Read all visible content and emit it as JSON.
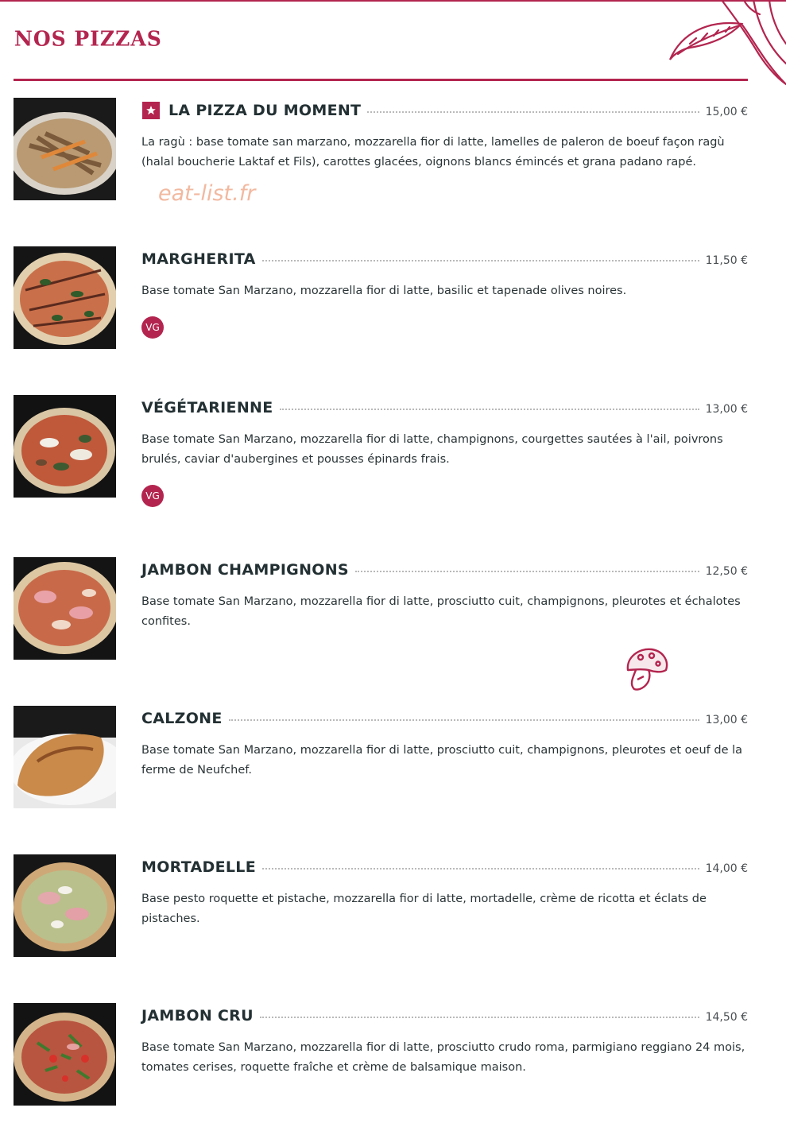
{
  "section": {
    "title": "NOS PIZZAS"
  },
  "watermark": "eat-list.fr",
  "items": [
    {
      "name": "LA PIZZA DU MOMENT",
      "price": "15,00 €",
      "description": "La ragù : base tomate san marzano, mozzarella fior di latte, lamelles de paleron de boeuf façon ragù (halal boucherie Laktaf et Fils), carottes glacées, oignons blancs émincés et grana padano rapé.",
      "featured_icon": "star-icon"
    },
    {
      "name": "MARGHERITA",
      "price": "11,50 €",
      "description": "Base tomate San Marzano, mozzarella fior di latte, basilic et tapenade olives noires.",
      "badge": "VG"
    },
    {
      "name": "VÉGÉTARIENNE",
      "price": "13,00 €",
      "description": "Base tomate San Marzano, mozzarella fior di latte, champignons, courgettes sautées à l'ail, poivrons brulés, caviar d'aubergines et pousses épinards frais.",
      "badge": "VG"
    },
    {
      "name": "JAMBON CHAMPIGNONS",
      "price": "12,50 €",
      "description": "Base tomate San Marzano, mozzarella fior di latte, prosciutto cuit, champignons, pleurotes et échalotes confites."
    },
    {
      "name": "CALZONE",
      "price": "13,00 €",
      "description": "Base tomate San Marzano, mozzarella fior di latte, prosciutto cuit, champignons, pleurotes et oeuf de la ferme de Neufchef."
    },
    {
      "name": "MORTADELLE",
      "price": "14,00 €",
      "description": "Base pesto roquette et pistache, mozzarella fior di latte, mortadelle, crème de ricotta et éclats de pistaches."
    },
    {
      "name": "JAMBON CRU",
      "price": "14,50 €",
      "description": "Base tomate San Marzano, mozzarella fior di latte, prosciutto crudo roma, parmigiano reggiano 24 mois, tomates cerises, roquette fraîche et crème de balsamique maison."
    }
  ],
  "colors": {
    "accent": "#b3254f",
    "text": "#233033",
    "watermark": "#f2b9a0"
  },
  "icons": {
    "decor": "leaf-decoration-icon",
    "mushroom": "mushroom-icon"
  }
}
